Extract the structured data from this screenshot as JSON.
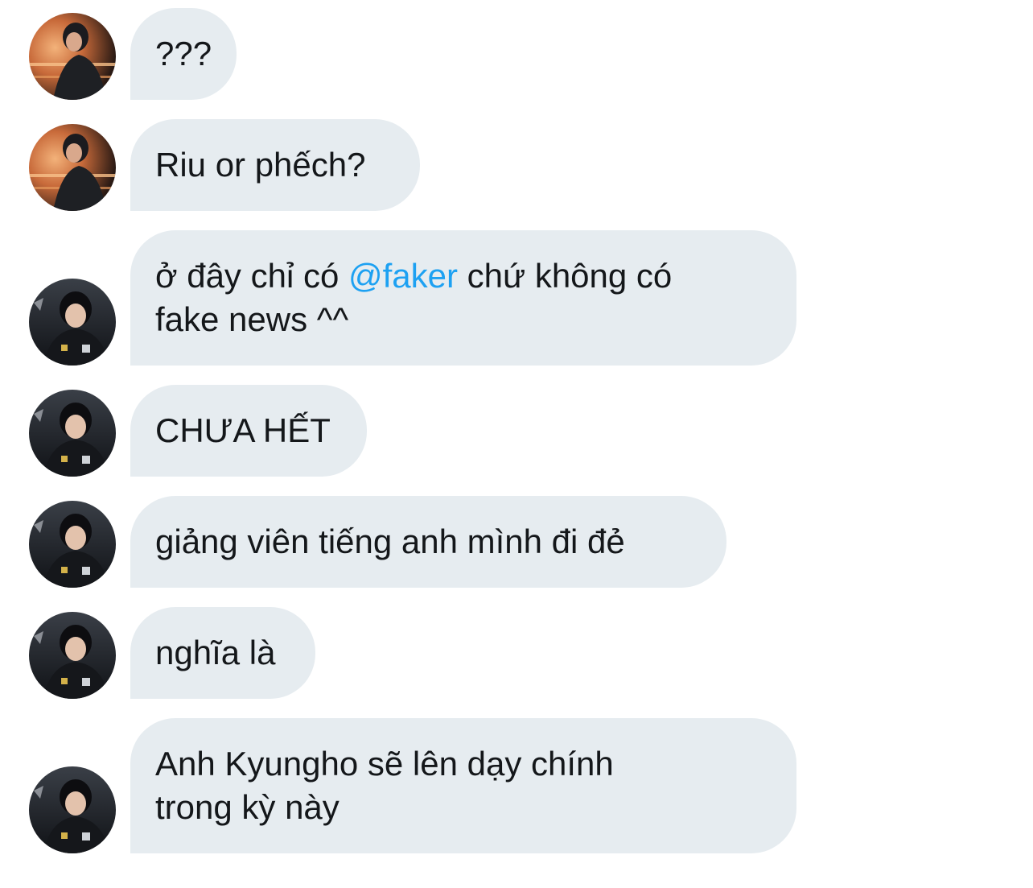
{
  "colors": {
    "bubble_bg": "#e6ecf0",
    "text": "#14171a",
    "mention": "#1da1f2",
    "background": "#ffffff"
  },
  "avatars": {
    "sender_a": "photo of a person in dark hoodie at gaming booth with orange lights",
    "sender_b": "photo of a person in black esports jersey at a desk"
  },
  "messages": [
    {
      "avatar": "sender_a",
      "text": "???"
    },
    {
      "avatar": "sender_a",
      "text": "Riu or phếch?"
    },
    {
      "avatar": "sender_b",
      "line1_pre": "ở đây chỉ có ",
      "mention": "@faker",
      "line1_post": " chứ không có",
      "line2": "fake news ^^"
    },
    {
      "avatar": "sender_b",
      "text": "CHƯA HẾT"
    },
    {
      "avatar": "sender_b",
      "text": "giảng viên tiếng anh mình đi đẻ"
    },
    {
      "avatar": "sender_b",
      "text": "nghĩa là"
    },
    {
      "avatar": "sender_b",
      "line1": "Anh Kyungho sẽ lên dạy chính",
      "line2": "trong kỳ này"
    }
  ]
}
